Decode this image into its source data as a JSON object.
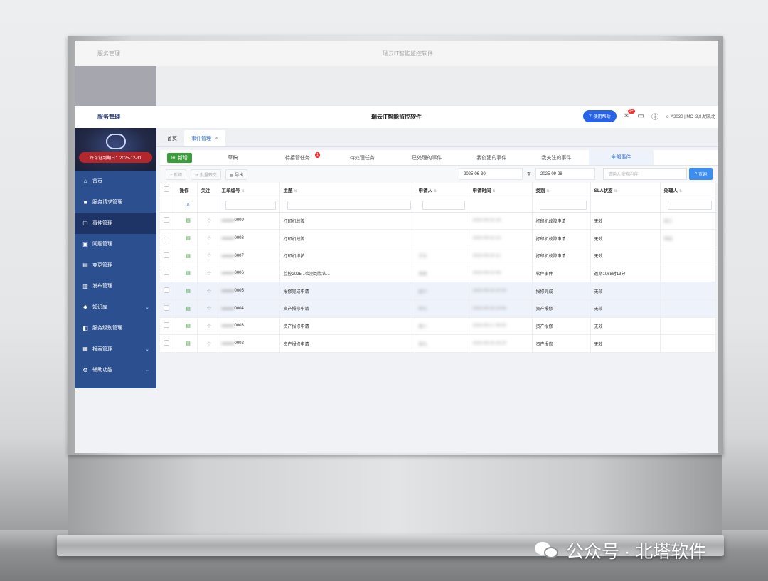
{
  "app": {
    "module": "服务管理",
    "title": "瑞云IT智能监控软件",
    "help_label": "使用帮助",
    "msg_count": "9+",
    "user": "A2030 | MC_3,8,胡凯北"
  },
  "sidebar": {
    "license": "许可证到期日：2025-12-31",
    "items": [
      {
        "label": "首页",
        "icon": "home-icon"
      },
      {
        "label": "服务请求管理",
        "icon": "briefcase-icon"
      },
      {
        "label": "事件管理",
        "icon": "edit-icon"
      },
      {
        "label": "问题管理",
        "icon": "question-icon"
      },
      {
        "label": "变更管理",
        "icon": "swap-icon"
      },
      {
        "label": "发布管理",
        "icon": "document-icon"
      },
      {
        "label": "知识库",
        "icon": "graduation-icon"
      },
      {
        "label": "服务级别管理",
        "icon": "layers-icon"
      },
      {
        "label": "报表管理",
        "icon": "report-icon"
      },
      {
        "label": "辅助功能",
        "icon": "tools-icon"
      }
    ]
  },
  "tabs": {
    "home": "首页",
    "current": "事件管理"
  },
  "subtabs": {
    "new": "新增",
    "items": [
      "草稿",
      "待接管任务",
      "待处理任务",
      "已处理的事件",
      "我创建的事件",
      "我关注的事件",
      "全部事件"
    ],
    "badge": "1"
  },
  "toolbar": {
    "add": "新增",
    "batch": "批量转交",
    "export": "导出",
    "date_from": "2025-06-30",
    "to": "至",
    "date_to": "2025-09-28",
    "search_placeholder": "请输入搜索内容",
    "search_btn": "查询"
  },
  "table": {
    "headers": [
      "操作",
      "关注",
      "工单编号",
      "主题",
      "申请人",
      "申请时间",
      "类别",
      "SLA状态",
      "处理人"
    ],
    "rows": [
      {
        "no": "0009",
        "subject": "打印机故障",
        "applicant": "",
        "time": "2025-09-25 16:",
        "category": "打印机故障申请",
        "sla": "无效",
        "handler": "张三"
      },
      {
        "no": "0008",
        "subject": "打印机故障",
        "applicant": "",
        "time": "2025-09-25 15:",
        "category": "打印机故障申请",
        "sla": "无效",
        "handler": "李四"
      },
      {
        "no": "0007",
        "subject": "打印机维护",
        "applicant": "王五",
        "time": "2025-09-24 11:",
        "category": "打印机故障申请",
        "sla": "无效",
        "handler": ""
      },
      {
        "no": "0006",
        "subject": "监控2025...检测到默认...",
        "applicant": "系统",
        "time": "2025-09-23 08:",
        "category": "软件事件",
        "sla": "逾期1068时13分",
        "handler": ""
      },
      {
        "no": "0005",
        "subject": "报修完成申请",
        "applicant": "赵六",
        "time": "2025-09-19 10:19",
        "category": "报修完成",
        "sla": "无效",
        "handler": ""
      },
      {
        "no": "0004",
        "subject": "资产报修申请",
        "applicant": "孙七",
        "time": "2025-09-18 14:45",
        "category": "资产报修",
        "sla": "无效",
        "handler": ""
      },
      {
        "no": "0003",
        "subject": "资产报修申请",
        "applicant": "周八",
        "time": "2025-09-17 09:30",
        "category": "资产报修",
        "sla": "无效",
        "handler": ""
      },
      {
        "no": "0002",
        "subject": "资产报修申请",
        "applicant": "吴九",
        "time": "2025-09-16 16:20",
        "category": "资产报修",
        "sla": "无效",
        "handler": ""
      }
    ]
  },
  "watermark": "公众号 · 北塔软件"
}
